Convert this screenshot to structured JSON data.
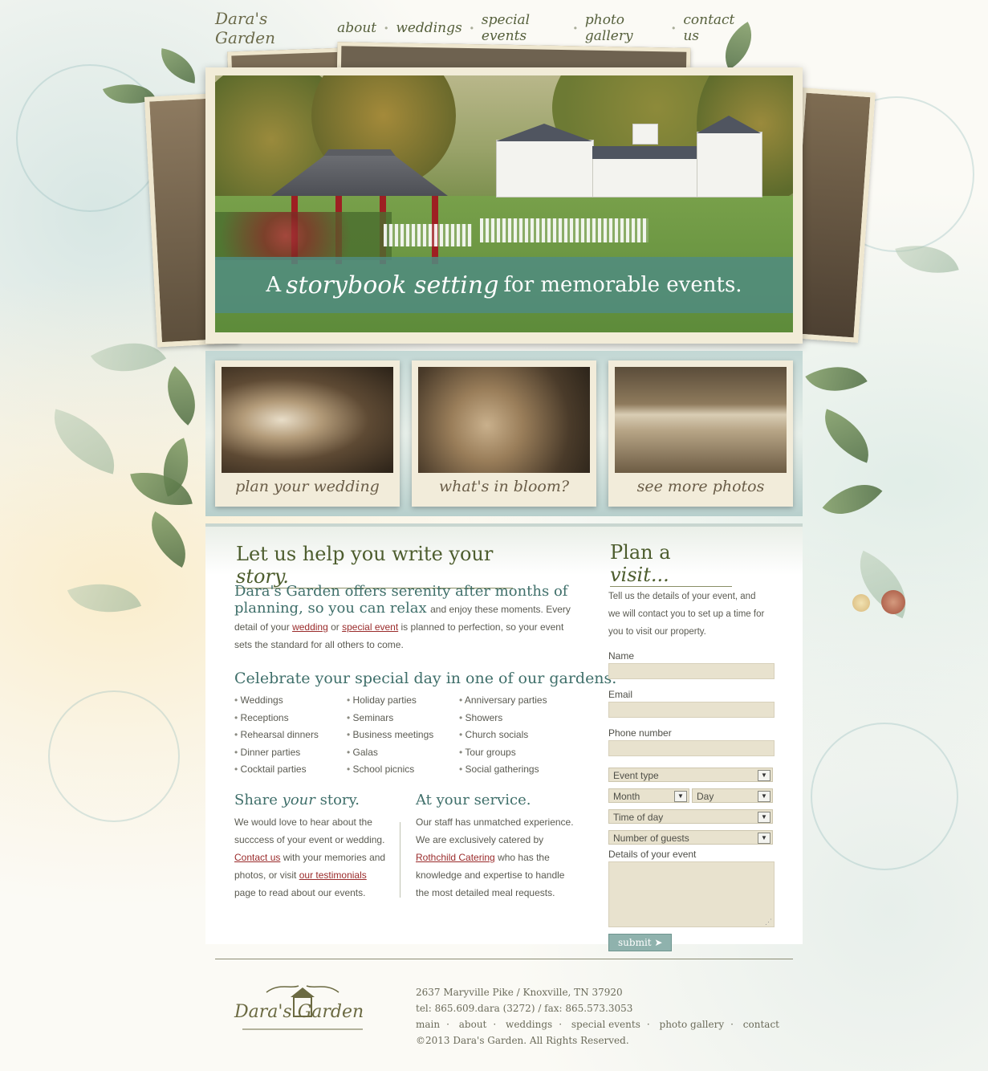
{
  "nav": {
    "logo": "Dara's Garden",
    "items": [
      "about",
      "weddings",
      "special events",
      "photo gallery",
      "contact us"
    ]
  },
  "hero": {
    "banner_prefix": "A",
    "banner_script": "storybook setting",
    "banner_suffix": "for memorable events."
  },
  "thumbs": [
    {
      "caption": "plan your wedding"
    },
    {
      "caption": "what's in bloom?"
    },
    {
      "caption": "see more photos"
    }
  ],
  "main": {
    "heading_prefix": "Let us help you write your",
    "heading_script": "story.",
    "lead_1": "Dara's Garden offers serenity after months of",
    "lead_2": "planning, so you can relax",
    "lead_tail": "and enjoy these moments. Every",
    "para_a": "detail of your",
    "link_wedding": "wedding",
    "para_or": "or",
    "link_special": "special event",
    "para_b": "is planned to perfection, so your event",
    "para_c": "sets the standard for all others to come.",
    "celebrate_heading": "Celebrate your special day in one of our gardens.",
    "col1": [
      "Weddings",
      "Receptions",
      "Rehearsal dinners",
      "Dinner parties",
      "Cocktail parties"
    ],
    "col2": [
      "Holiday parties",
      "Seminars",
      "Business meetings",
      "Galas",
      "School picnics"
    ],
    "col3": [
      "Anniversary parties",
      "Showers",
      "Church socials",
      "Tour groups",
      "Social gatherings"
    ],
    "share": {
      "heading_a": "Share",
      "heading_em": "your",
      "heading_b": "story.",
      "line1": "We would love to hear about the",
      "line2": "succcess of your event or wedding.",
      "link_contact": "Contact us",
      "line3": "with your memories and",
      "line4": "photos, or visit",
      "link_testimonials": "our testimonials",
      "line5": "page to read about our events."
    },
    "service": {
      "heading": "At your service.",
      "line1": "Our staff has unmatched experience.",
      "line2": "We are exclusively catered by",
      "link_rothchild": "Rothchild Catering",
      "line3": "who has the",
      "line4": "knowledge and expertise to handle",
      "line5": "the most detailed meal requests."
    }
  },
  "visit": {
    "heading_a": "Plan a",
    "heading_script": "visit...",
    "intro_1": "Tell us the details of your event, and",
    "intro_2": "we will contact you to set up a time for",
    "intro_3": "you to visit our property.",
    "label_name": "Name",
    "label_email": "Email",
    "label_phone": "Phone number",
    "select_event": "Event type",
    "select_month": "Month",
    "select_day": "Day",
    "select_time": "Time of day",
    "select_guests": "Number of guests",
    "label_details": "Details of your event",
    "submit": "submit ➤"
  },
  "footer": {
    "logo": "Dara's Garden",
    "address": "2637 Maryville Pike / Knoxville, TN 37920",
    "phone": "tel: 865.609.dara (3272) / fax: 865.573.3053",
    "links": [
      "main",
      "about",
      "weddings",
      "special events",
      "photo gallery",
      "contact"
    ],
    "copyright": "©2013 Dara's Garden. All Rights Reserved."
  },
  "colors": {
    "accent_teal": "#508c80",
    "link_red": "#9a2b2b",
    "olive": "#4d5d2e"
  }
}
